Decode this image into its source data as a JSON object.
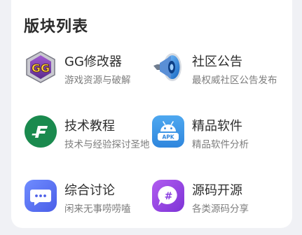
{
  "section": {
    "title": "版块列表"
  },
  "forums": [
    {
      "name": "GG修改器",
      "desc": "游戏资源与破解",
      "icon": "gg-logo-icon"
    },
    {
      "name": "社区公告",
      "desc": "最权威社区公告发布",
      "icon": "megaphone-icon"
    },
    {
      "name": "技术教程",
      "desc": "技术与经验探讨圣地",
      "icon": "f-logo-icon"
    },
    {
      "name": "精品软件",
      "desc": "精品软件分析",
      "icon": "android-apk-icon"
    },
    {
      "name": "综合讨论",
      "desc": "闲来无事唠唠嗑",
      "icon": "chat-bubble-icon"
    },
    {
      "name": "源码开源",
      "desc": "各类源码分享",
      "icon": "hash-bubble-icon"
    }
  ],
  "colors": {
    "card_bg": "#ffffff",
    "page_bg": "#f0f1f5",
    "title_text": "#2b2b2b",
    "desc_text": "#7d7d7d"
  }
}
